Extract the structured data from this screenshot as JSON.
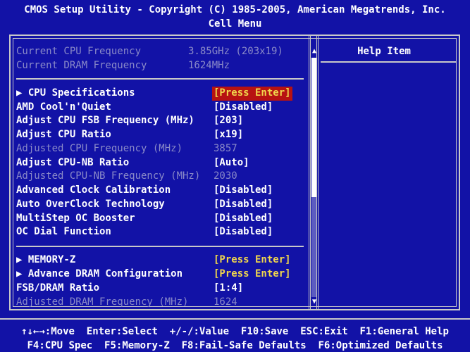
{
  "header": {
    "title": "CMOS Setup Utility - Copyright (C) 1985-2005, American Megatrends, Inc.",
    "menu": "Cell Menu"
  },
  "help": {
    "title": "Help Item"
  },
  "info": [
    {
      "label": "Current CPU Frequency",
      "value": "3.85GHz (203x19)"
    },
    {
      "label": "Current DRAM Frequency",
      "value": "1624MHz"
    }
  ],
  "settings": [
    {
      "label": "▶ CPU Specifications",
      "value": "[Press Enter]",
      "selected": true
    },
    {
      "label": "AMD Cool'n'Quiet",
      "value": "[Disabled]"
    },
    {
      "label": "Adjust CPU FSB Frequency (MHz)",
      "value": "[203]"
    },
    {
      "label": "Adjust CPU Ratio",
      "value": "[x19]"
    },
    {
      "label": "Adjusted CPU Frequency (MHz)",
      "value": "3857",
      "disabled": true
    },
    {
      "label": "Adjust CPU-NB Ratio",
      "value": "[Auto]"
    },
    {
      "label": "Adjusted CPU-NB Frequency (MHz)",
      "value": "2030",
      "disabled": true
    },
    {
      "label": "Advanced Clock Calibration",
      "value": "[Disabled]"
    },
    {
      "label": "Auto OverClock Technology",
      "value": "[Disabled]"
    },
    {
      "label": "MultiStep OC Booster",
      "value": "[Disabled]"
    },
    {
      "label": "OC Dial Function",
      "value": "[Disabled]"
    }
  ],
  "memory": [
    {
      "label": "▶ MEMORY-Z",
      "value": "[Press Enter]"
    },
    {
      "label": "▶ Advance DRAM Configuration",
      "value": "[Press Enter]"
    },
    {
      "label": "FSB/DRAM Ratio",
      "value": "[1:4]"
    },
    {
      "label": "Adjusted DRAM Frequency (MHz)",
      "value": "1624",
      "disabled": true
    }
  ],
  "footer": {
    "line1": "↑↓←→:Move  Enter:Select  +/-/:Value  F10:Save  ESC:Exit  F1:General Help",
    "line2": "F4:CPU Spec  F5:Memory-Z  F8:Fail-Safe Defaults  F6:Optimized Defaults"
  },
  "scroll": {
    "up_icon": "▲",
    "down_icon": "▼"
  },
  "colors": {
    "background": "#1212a6",
    "highlight": "#b71212",
    "accent": "#f0d64c",
    "dim": "#8a8ac8"
  }
}
